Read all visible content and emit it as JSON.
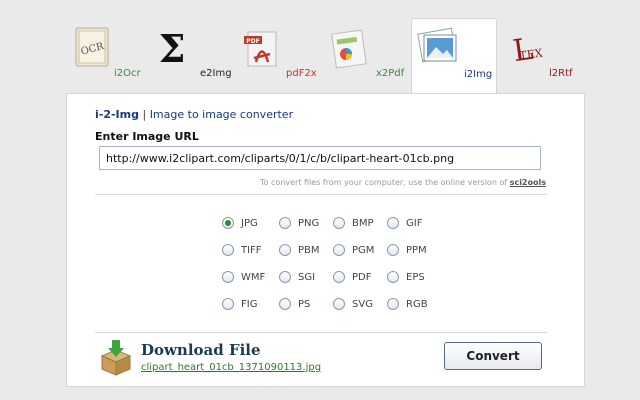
{
  "tabs": [
    {
      "label": "i2Ocr",
      "icon": "ocr-icon",
      "active": false
    },
    {
      "label": "e2Img",
      "icon": "sigma-icon",
      "active": false
    },
    {
      "label": "pdF2x",
      "icon": "pdf-icon",
      "active": false
    },
    {
      "label": "x2Pdf",
      "icon": "spreadsheet-icon",
      "active": false
    },
    {
      "label": "i2Img",
      "icon": "image-icon",
      "active": true
    },
    {
      "label": "l2Rtf",
      "icon": "latex-icon",
      "active": false
    }
  ],
  "header": {
    "brand": "i-2-Img",
    "separator": " | ",
    "subtitle": "Image to image converter"
  },
  "url": {
    "label": "Enter Image URL",
    "value": "http://www.i2clipart.com/cliparts/0/1/c/b/clipart-heart-01cb.png"
  },
  "hint": {
    "text": "To convert files from your computer, use the online version of ",
    "link": "sci2ools"
  },
  "formats": {
    "selected": "JPG",
    "rows": [
      [
        "JPG",
        "PNG",
        "BMP",
        "GIF"
      ],
      [
        "TIFF",
        "PBM",
        "PGM",
        "PPM"
      ],
      [
        "WMF",
        "SGI",
        "PDF",
        "EPS"
      ],
      [
        "FIG",
        "PS",
        "SVG",
        "RGB"
      ]
    ]
  },
  "download": {
    "title": "Download File",
    "filename": "clipart_heart_01cb_1371090113.jpg",
    "icon": "download-box-icon"
  },
  "convert_label": "Convert",
  "colors": {
    "brand_blue": "#1a3a7a",
    "link_green": "#2a7a2a",
    "radio_selected": "#2f8a2f"
  }
}
